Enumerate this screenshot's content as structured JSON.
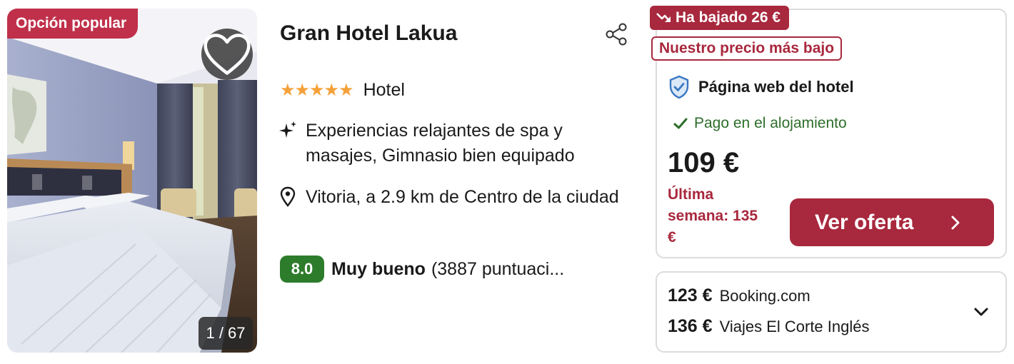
{
  "listing": {
    "popular_badge": "Opción popular",
    "photo_counter": "1 / 67",
    "hotel_name": "Gran Hotel Lakua",
    "stars": "★★★★★",
    "star_count": 5,
    "hotel_type": "Hotel",
    "amenities": "Experiencias relajantes de spa y masajes, Gimnasio bien equipado",
    "location": "Vitoria, a 2.9 km de Centro de la ciudad",
    "rating": {
      "score": "8.0",
      "label": "Muy bueno",
      "count": "(3887 puntuaci..."
    }
  },
  "offer": {
    "drop_badge": "Ha bajado 26 €",
    "lowest_badge": "Nuestro precio más bajo",
    "provider": "Página web del hotel",
    "payment": "Pago en el alojamiento",
    "price": "109 €",
    "last_week": "Última semana: 135 €",
    "cta_label": "Ver oferta"
  },
  "other_offers": [
    {
      "price": "123 €",
      "provider": "Booking.com"
    },
    {
      "price": "136 €",
      "provider": "Viajes El Corte Inglés"
    }
  ],
  "colors": {
    "brand_red": "#a8283d",
    "popular_red": "#c0304a",
    "rating_green": "#2d7c2b",
    "star_orange": "#f5a13a",
    "pay_green": "#2d6e2a"
  },
  "icons": {
    "favorite": "heart-icon",
    "share": "share-icon",
    "amenities": "sparkle-icon",
    "location": "map-pin-icon",
    "provider": "shield-check-icon",
    "payment": "checkmark-icon",
    "drop": "trend-down-icon",
    "cta": "chevron-right-icon",
    "expand": "chevron-down-icon"
  }
}
